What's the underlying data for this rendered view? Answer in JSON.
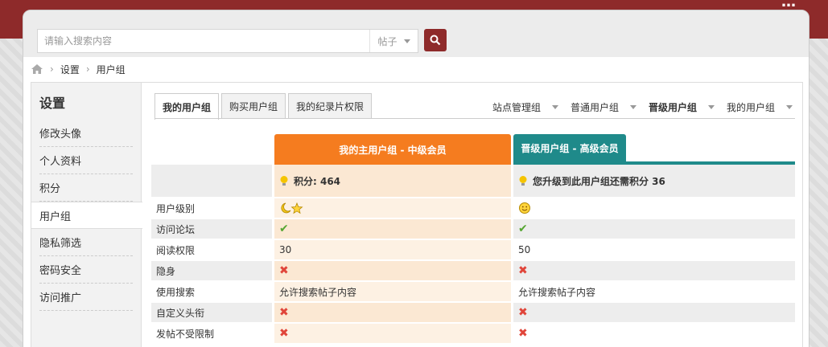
{
  "header": {
    "corner_text": "…"
  },
  "search": {
    "placeholder": "请输入搜索内容",
    "type_label": "帖子",
    "icon": "search-icon"
  },
  "breadcrumb": {
    "items": [
      "设置",
      "用户组"
    ]
  },
  "sidebar": {
    "title": "设置",
    "items": [
      "修改头像",
      "个人资料",
      "积分",
      "用户组",
      "隐私筛选",
      "密码安全",
      "访问推广"
    ],
    "active_index": 3
  },
  "tabs": [
    {
      "label": "我的用户组",
      "active": true
    },
    {
      "label": "购买用户组",
      "active": false
    },
    {
      "label": "我的纪录片权限",
      "active": false
    }
  ],
  "group_nav": [
    {
      "label": "站点管理组",
      "bold": false
    },
    {
      "label": "普通用户组",
      "bold": false
    },
    {
      "label": "晋级用户组",
      "bold": true
    },
    {
      "label": "我的用户组",
      "bold": false
    }
  ],
  "table": {
    "col1_header": "我的主用户组 - 中级会员",
    "col2_header": "晋级用户组 - 高级会员",
    "points_c1": "积分: 464",
    "points_c2": "您升级到此用户组还需积分 36",
    "rows": [
      {
        "label": "用户级别",
        "c1": "moon-star",
        "c2": "smiley"
      },
      {
        "label": "访问论坛",
        "c1": "check",
        "c2": "check"
      },
      {
        "label": "阅读权限",
        "c1": "30",
        "c2": "50"
      },
      {
        "label": "隐身",
        "c1": "cross",
        "c2": "cross"
      },
      {
        "label": "使用搜索",
        "c1": "允许搜索帖子内容",
        "c2": "允许搜索帖子内容"
      },
      {
        "label": "自定义头衔",
        "c1": "cross",
        "c2": "cross"
      },
      {
        "label": "发帖不受限制",
        "c1": "cross",
        "c2": "cross"
      }
    ]
  },
  "colors": {
    "brand": "#8e2a2a",
    "orange": "#f57c1f",
    "teal": "#1f8a8a",
    "check": "#55a631",
    "cross": "#e0453a"
  }
}
